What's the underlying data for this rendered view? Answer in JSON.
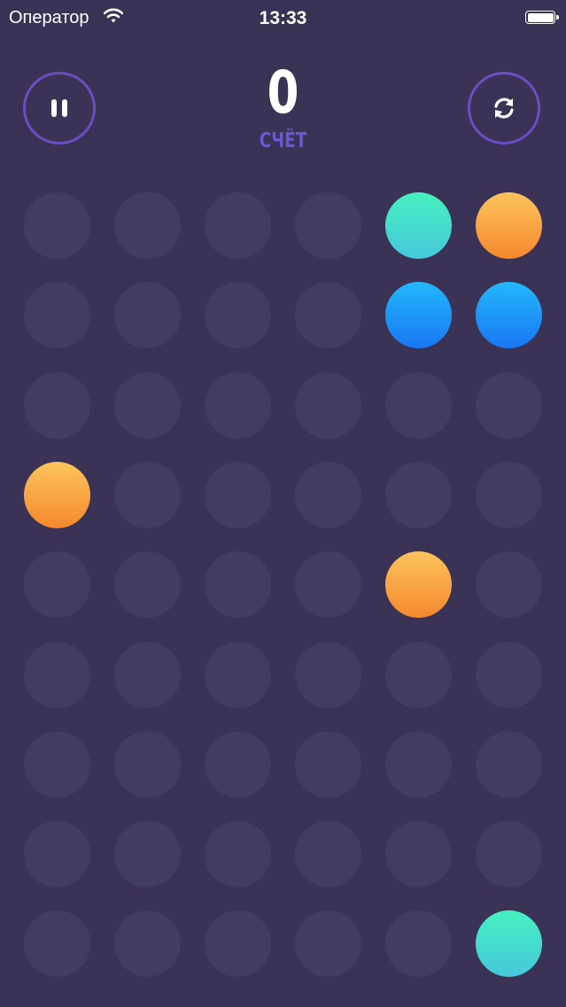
{
  "status_bar": {
    "carrier": "Оператор",
    "time": "13:33"
  },
  "header": {
    "score": "0",
    "score_label": "СЧЁТ"
  },
  "icons": {
    "pause": "pause-icon",
    "restart": "refresh-icon",
    "wifi": "wifi-icon",
    "battery": "battery-icon"
  },
  "colors": {
    "background": "#3b3355",
    "empty_cell": "#423d5f",
    "button_ring": "#6a4fc4",
    "score_label": "#6d56d2",
    "green": "#45e6c2",
    "orange": "#f9a644",
    "blue": "#1f9af8"
  },
  "board": {
    "rows": 9,
    "cols": 6,
    "cells": [
      [
        "empty",
        "empty",
        "empty",
        "empty",
        "green",
        "orange"
      ],
      [
        "empty",
        "empty",
        "empty",
        "empty",
        "blue",
        "blue"
      ],
      [
        "empty",
        "empty",
        "empty",
        "empty",
        "empty",
        "empty"
      ],
      [
        "orange",
        "empty",
        "empty",
        "empty",
        "empty",
        "empty"
      ],
      [
        "empty",
        "empty",
        "empty",
        "empty",
        "orange",
        "empty"
      ],
      [
        "empty",
        "empty",
        "empty",
        "empty",
        "empty",
        "empty"
      ],
      [
        "empty",
        "empty",
        "empty",
        "empty",
        "empty",
        "empty"
      ],
      [
        "empty",
        "empty",
        "empty",
        "empty",
        "empty",
        "empty"
      ],
      [
        "empty",
        "empty",
        "empty",
        "empty",
        "empty",
        "green"
      ]
    ]
  }
}
